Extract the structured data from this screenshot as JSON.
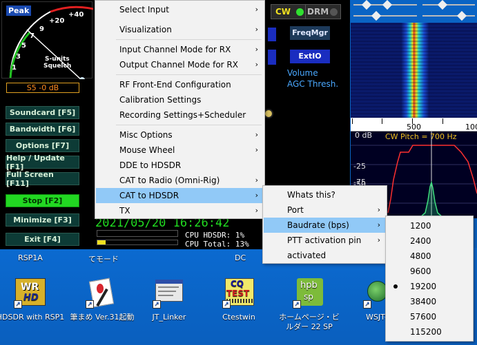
{
  "smeter": {
    "peak_label": "Peak",
    "scale_top": "+40",
    "scale_mid": "+20",
    "scale_9": "9",
    "scale_7": "7",
    "scale_5": "5",
    "scale_3": "3",
    "scale_1": "1",
    "units_label": "S-units",
    "squelch_label": "Squelch",
    "reading": "S5 -0 dB"
  },
  "buttons": [
    {
      "label": "Soundcard  [F5]"
    },
    {
      "label": "Bandwidth  [F6]"
    },
    {
      "label": "Options   [F7]"
    },
    {
      "label": "Help / Update  [F1]"
    },
    {
      "label": "Full Screen  [F11]"
    },
    {
      "label": "Stop        [F2]"
    },
    {
      "label": "Minimize  [F3]"
    },
    {
      "label": "Exit        [F4]"
    }
  ],
  "top_right": {
    "cw": "CW",
    "drm": "DRM",
    "freqmgr": "FreqMgr",
    "extio": "ExtIO",
    "volume": "Volume",
    "agc": "AGC Thresh."
  },
  "spectrum": {
    "tick_500": "500",
    "tick_100": "100",
    "db0": "0 dB",
    "db25": "-25",
    "db50": "-50",
    "db75": "-75",
    "cw_pitch": "CW Pitch = 700 Hz"
  },
  "status": {
    "datetime": "2021/05/20 16:26:42",
    "cpu_hdsdr": "CPU HDSDR: 1%",
    "cpu_total": "CPU Total: 13%"
  },
  "menu_main": [
    {
      "label": "Select Input",
      "arrow": "›"
    },
    {
      "label": "Visualization",
      "arrow": "›"
    },
    {
      "label": "Input Channel Mode for RX",
      "arrow": "›"
    },
    {
      "label": "Output Channel Mode for RX",
      "arrow": "›"
    },
    {
      "label": "RF Front-End Configuration",
      "arrow": ""
    },
    {
      "label": "Calibration Settings",
      "arrow": ""
    },
    {
      "label": "Recording Settings+Scheduler",
      "arrow": ""
    },
    {
      "label": "Misc Options",
      "arrow": "›"
    },
    {
      "label": "Mouse Wheel",
      "arrow": "›"
    },
    {
      "label": "DDE to HDSDR",
      "arrow": ""
    },
    {
      "label": "CAT to Radio (Omni-Rig)",
      "arrow": "›"
    },
    {
      "label": "CAT to HDSDR",
      "arrow": "›"
    },
    {
      "label": "TX",
      "arrow": "›"
    }
  ],
  "menu_cat": [
    {
      "label": "Whats this?",
      "arrow": ""
    },
    {
      "label": "Port",
      "arrow": "›"
    },
    {
      "label": "Baudrate (bps)",
      "arrow": "›"
    },
    {
      "label": "PTT activation pin",
      "arrow": "›"
    },
    {
      "label": "activated",
      "arrow": ""
    }
  ],
  "menu_baud": [
    "1200",
    "2400",
    "4800",
    "9600",
    "19200",
    "38400",
    "57600",
    "115200"
  ],
  "baud_selected": "19200",
  "desktop_top": [
    "RSP1A",
    "てモード",
    "DC"
  ],
  "desktop_icons": [
    {
      "label": "HDSDR with RSP1",
      "icon": "hdsdr-icon"
    },
    {
      "label": "筆まめ Ver.31起動",
      "icon": "fudemame-icon"
    },
    {
      "label": "JT_Linker",
      "icon": "jtlinker-icon"
    },
    {
      "label": "Ctestwin",
      "icon": "ctestwin-icon"
    },
    {
      "label": "ホームページ・ビルダー 22 SP",
      "icon": "hpb-icon"
    },
    {
      "label": "WSJT-",
      "icon": "wsjt-icon"
    }
  ]
}
